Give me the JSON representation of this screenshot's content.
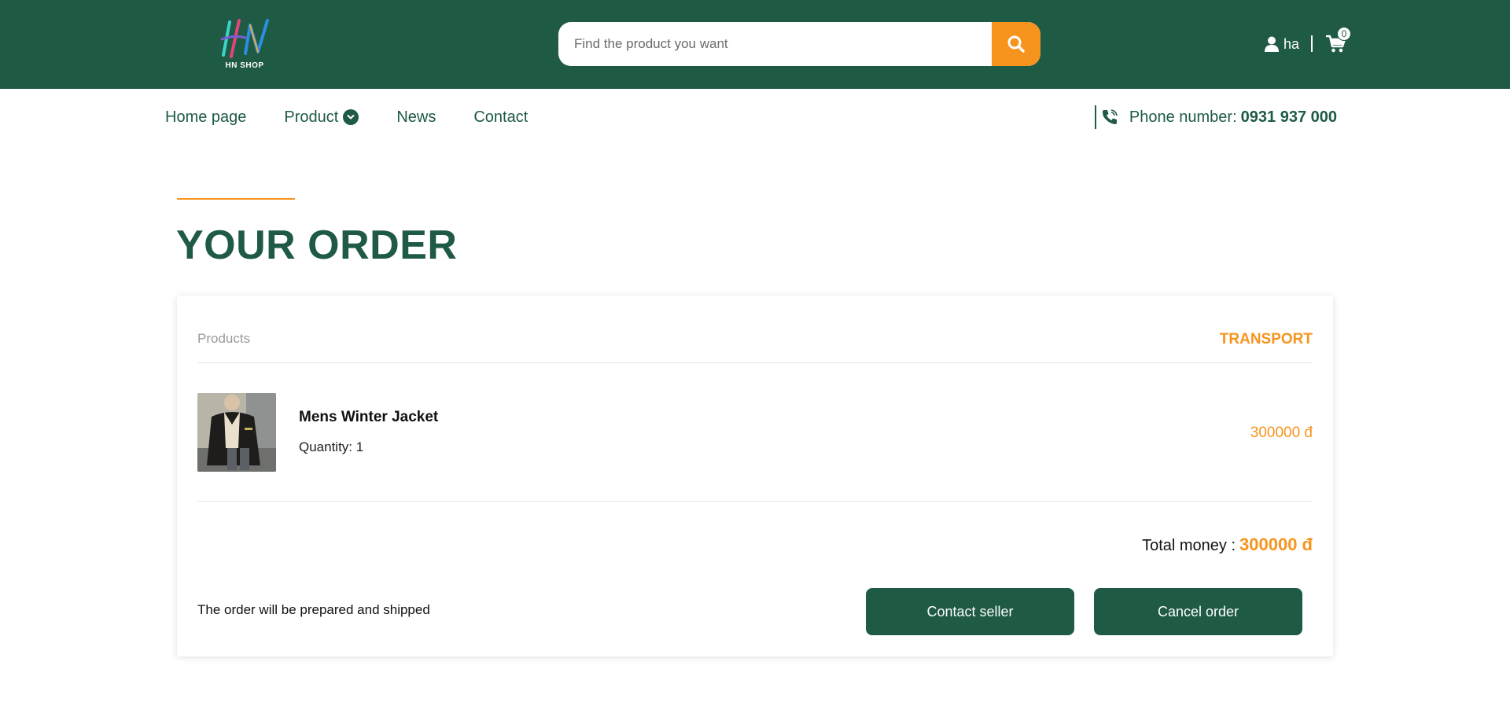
{
  "header": {
    "logo_text": "HN SHOP",
    "search_placeholder": "Find the product you want",
    "user_name": "ha",
    "cart_count": "0",
    "colors": {
      "header_bg": "#1e5a44",
      "accent": "#f7941d"
    },
    "icons": {
      "search": "search-icon",
      "user": "user-icon",
      "cart": "cart-icon"
    }
  },
  "nav": {
    "items": [
      {
        "label": "Home page"
      },
      {
        "label": "Product"
      },
      {
        "label": "News"
      },
      {
        "label": "Contact"
      }
    ],
    "phone_label": "Phone number:",
    "phone_number": "0931 937 000"
  },
  "page": {
    "title": "YOUR ORDER"
  },
  "order": {
    "products_header": "Products",
    "status_header": "TRANSPORT",
    "items": [
      {
        "name": "Mens Winter Jacket",
        "quantity_text": "Quantity: 1",
        "price": "300000 đ"
      }
    ],
    "total_label": "Total money :",
    "total_value": "300000 đ",
    "status_message": "The order will be prepared and shipped",
    "contact_button": "Contact seller",
    "cancel_button": "Cancel order"
  }
}
